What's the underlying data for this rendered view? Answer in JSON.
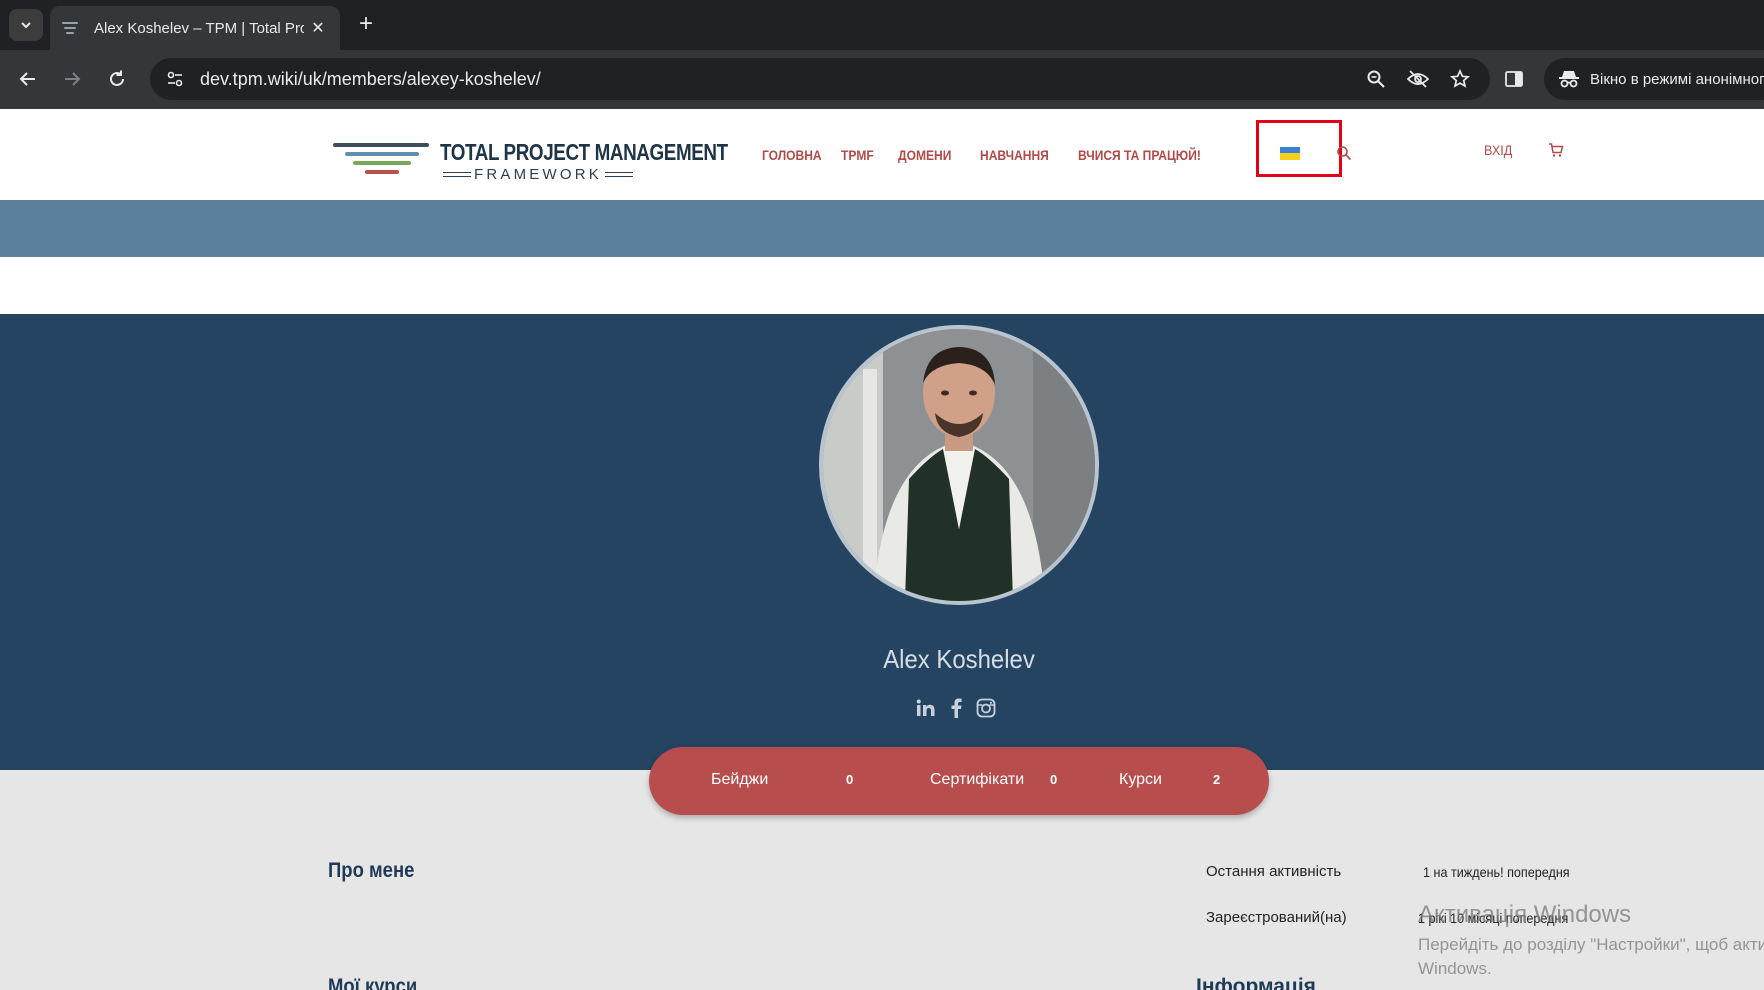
{
  "browser": {
    "tab_title": "Alex Koshelev – TPM | Total Project Management Framework",
    "url": "dev.tpm.wiki/uk/members/alexey-koshelev/",
    "incognito_label": "Вікно в режимі анонімного перегляду"
  },
  "site": {
    "brand_line1": "TOTAL PROJECT MANAGEMENT",
    "brand_line2": "FRAMEWORK",
    "nav": [
      {
        "label": "ГОЛОВНА"
      },
      {
        "label": "TPMF"
      },
      {
        "label": "ДОМЕНИ"
      },
      {
        "label": "НАВЧАННЯ"
      },
      {
        "label": "ВЧИСЯ ТА ПРАЦЮЙ!"
      }
    ],
    "login_label": "ВХІД"
  },
  "profile": {
    "name": "Alex Koshelev",
    "stats": [
      {
        "label": "Бейджи",
        "value": "0"
      },
      {
        "label": "Сертифікати",
        "value": "0"
      },
      {
        "label": "Курси",
        "value": "2"
      }
    ],
    "about_title": "Про мене",
    "meta": [
      {
        "label": "Остання активність",
        "value": "1 на тиждень! попередня"
      },
      {
        "label": "Зареєстрований(на)",
        "value": "1 рікі 10 місяці попередня"
      }
    ],
    "section2_title": "Мої курси",
    "section2_right": "Інформація"
  },
  "os_watermark": {
    "line1": "Активація Windows",
    "line2": "Перейдіть до розділу \"Настройки\", щоб активувати",
    "line3": "Windows."
  },
  "colors": {
    "accent_red": "#b74e4d",
    "hero_blue": "#244461",
    "banner_blue": "#5c7f9b",
    "highlight_red": "#e5001a"
  }
}
